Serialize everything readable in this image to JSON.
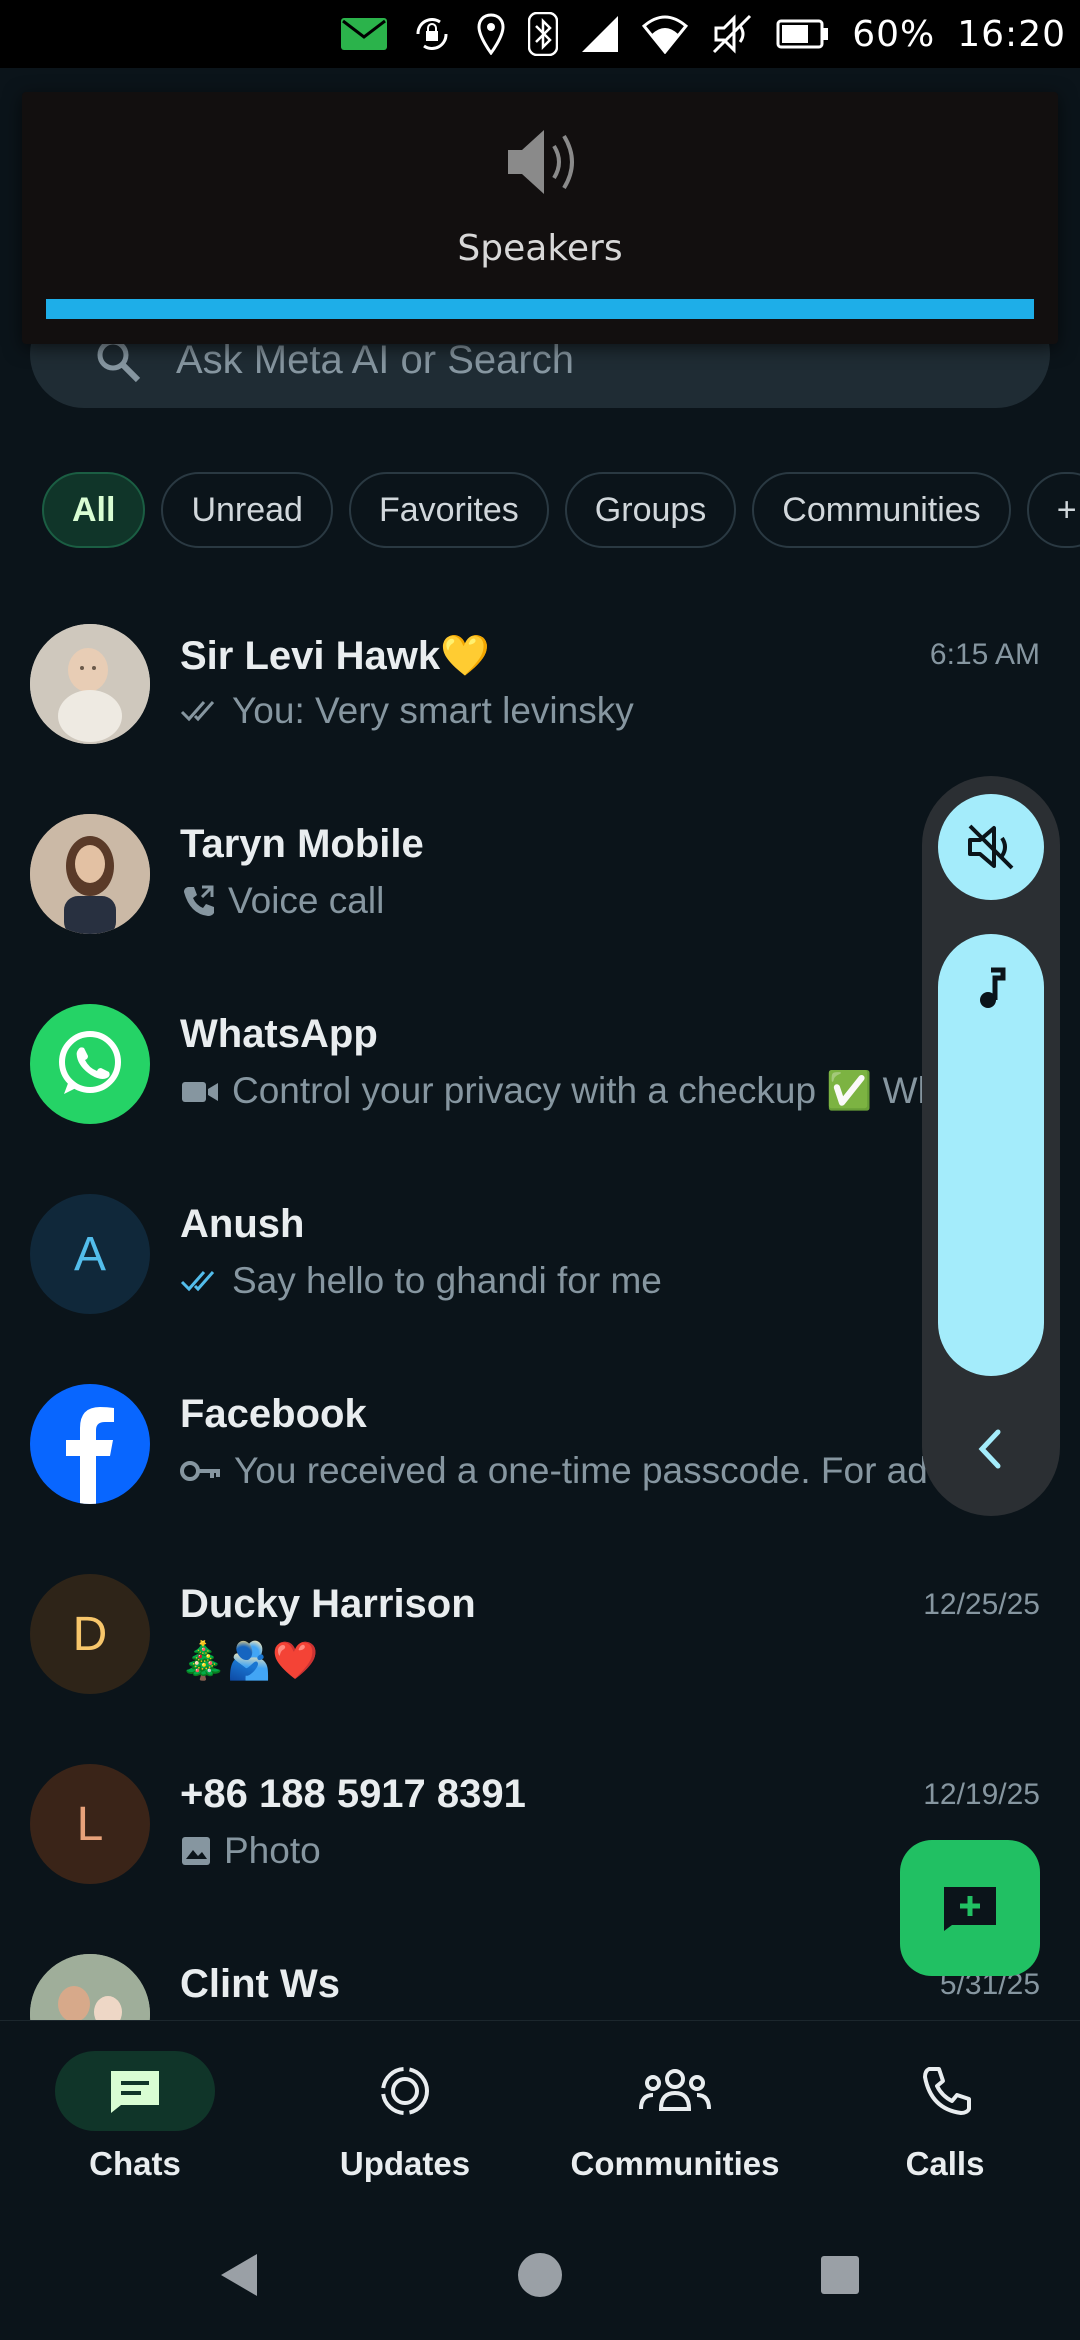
{
  "status_bar": {
    "battery": "60%",
    "time": "16:20"
  },
  "speaker_popup": {
    "label": "Speakers",
    "level_percent": 100,
    "accent": "#1eaee8"
  },
  "search": {
    "placeholder": "Ask Meta AI or Search"
  },
  "filters": [
    "All",
    "Unread",
    "Favorites",
    "Groups",
    "Communities",
    "+"
  ],
  "chats": [
    {
      "name": "Sir Levi Hawk💛",
      "preview": "You: Very smart levinsky",
      "time": "6:15 AM",
      "status": "read-grey",
      "avatar": "photo-baby"
    },
    {
      "name": "Taryn Mobile",
      "preview": "Voice call",
      "time": "",
      "status": "voice-call",
      "avatar": "photo-woman"
    },
    {
      "name": "WhatsApp",
      "preview": "Control your privacy with a checkup ✅ Wh",
      "time": "",
      "status": "video",
      "avatar": "whatsapp-logo"
    },
    {
      "name": "Anush",
      "preview": "Say hello to ghandi for me",
      "time": "",
      "status": "read-blue",
      "avatar": "A"
    },
    {
      "name": "Facebook",
      "preview": "You received a one-time passcode. For add",
      "time": "",
      "status": "key",
      "avatar": "facebook-logo"
    },
    {
      "name": "Ducky Harrison",
      "preview": "🎄🫂❤️",
      "time": "12/25/25",
      "status": "none",
      "avatar": "D"
    },
    {
      "name": "+86 188 5917 8391",
      "preview": "Photo",
      "time": "12/19/25",
      "status": "photo",
      "avatar": "L"
    },
    {
      "name": "Clint Ws",
      "preview": "",
      "time": "5/31/25",
      "status": "none",
      "avatar": "photo-family"
    }
  ],
  "volume_panel": {
    "mute_icon": "speaker-muted-icon",
    "stream_icon": "music-note-icon",
    "accent": "#a4ecfb"
  },
  "bottom_nav": [
    {
      "label": "Chats",
      "icon": "chat-icon",
      "active": true
    },
    {
      "label": "Updates",
      "icon": "status-ring-icon",
      "active": false
    },
    {
      "label": "Communities",
      "icon": "people-icon",
      "active": false
    },
    {
      "label": "Calls",
      "icon": "phone-icon",
      "active": false
    }
  ]
}
